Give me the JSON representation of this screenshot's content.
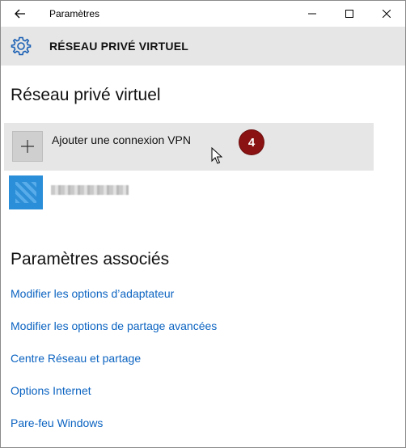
{
  "window": {
    "title": "Paramètres"
  },
  "header": {
    "title": "RÉSEAU PRIVÉ VIRTUEL",
    "icon": "gear-icon"
  },
  "main": {
    "heading": "Réseau privé virtuel",
    "add_vpn": {
      "label": "Ajouter une connexion VPN",
      "icon": "plus-icon"
    },
    "step_badge": "4",
    "vpn_connections": [
      {
        "name_redacted": true,
        "icon": "vpn-network-icon"
      }
    ]
  },
  "related": {
    "heading": "Paramètres associés",
    "links": [
      "Modifier les options d’adaptateur",
      "Modifier les options de partage avancées",
      "Centre Réseau et partage",
      "Options Internet",
      "Pare-feu Windows"
    ]
  },
  "colors": {
    "accent": "#0b63c1",
    "header_bg": "#e6e6e6",
    "badge": "#8b1212"
  }
}
